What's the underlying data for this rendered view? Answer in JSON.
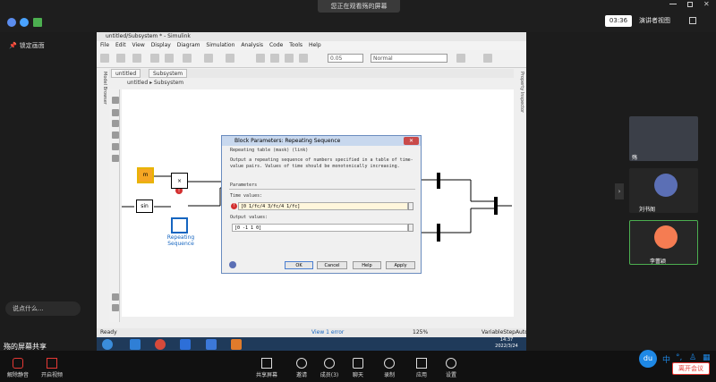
{
  "topbar": {
    "share_banner": "您正在观看殇的屏幕",
    "time": "03:36",
    "presenter_view": "演讲者视图"
  },
  "left_panel": {
    "lock_label": "锁定画面",
    "chat_placeholder": "说点什么...",
    "sharing_label": "殇的屏幕共享"
  },
  "simulink": {
    "title": "untitled/Subsystem * - Simulink",
    "menu": [
      "File",
      "Edit",
      "View",
      "Display",
      "Diagram",
      "Simulation",
      "Analysis",
      "Code",
      "Tools",
      "Help"
    ],
    "stop_time": "0.05",
    "sim_mode": "Normal",
    "tabs": [
      "untitled",
      "Subsystem"
    ],
    "breadcrumb": [
      "untitled",
      "Subsystem"
    ],
    "side_left": "Model Browser",
    "side_right": "Property Inspector",
    "blocks": {
      "m": "m",
      "sin": "sin",
      "multiply": "×",
      "repeating_label": "Repeating\nSequence"
    },
    "status_left": "Ready",
    "status_center": "View 1 error",
    "status_zoom": "125%",
    "status_solver": "VariableStepAuto"
  },
  "dialog": {
    "title": "Block Parameters: Repeating Sequence",
    "subtitle": "Repeating table (mask) (link)",
    "description": "Output a repeating sequence of numbers specified in a table of time-value pairs. Values of time should be monotonically increasing.",
    "section": "Parameters",
    "time_label": "Time values:",
    "time_value": "[0 1/fc/4 3/fc/4 1/fc]",
    "output_label": "Output values:",
    "output_value": "[0 -1 1 0]",
    "buttons": [
      "OK",
      "Cancel",
      "Help",
      "Apply"
    ]
  },
  "taskbar": {
    "time": "14:37",
    "date": "2022/3/24"
  },
  "participants": [
    {
      "name": "殇"
    },
    {
      "name": "刘书阁"
    },
    {
      "name": "李蕾颖"
    }
  ],
  "bottom_bar": {
    "mute": "解除静音",
    "video": "开启视频",
    "share": "共享屏幕",
    "invite": "邀请",
    "members": "成员(3)",
    "chat": "聊天",
    "record": "录制",
    "apps": "应用",
    "settings": "设置"
  },
  "du_bar": {
    "lang": "中",
    "end_button": "离开会议"
  },
  "colors": {
    "accent_blue": "#1e88e5",
    "error_red": "#d32f2f",
    "end_red": "#e53935"
  }
}
